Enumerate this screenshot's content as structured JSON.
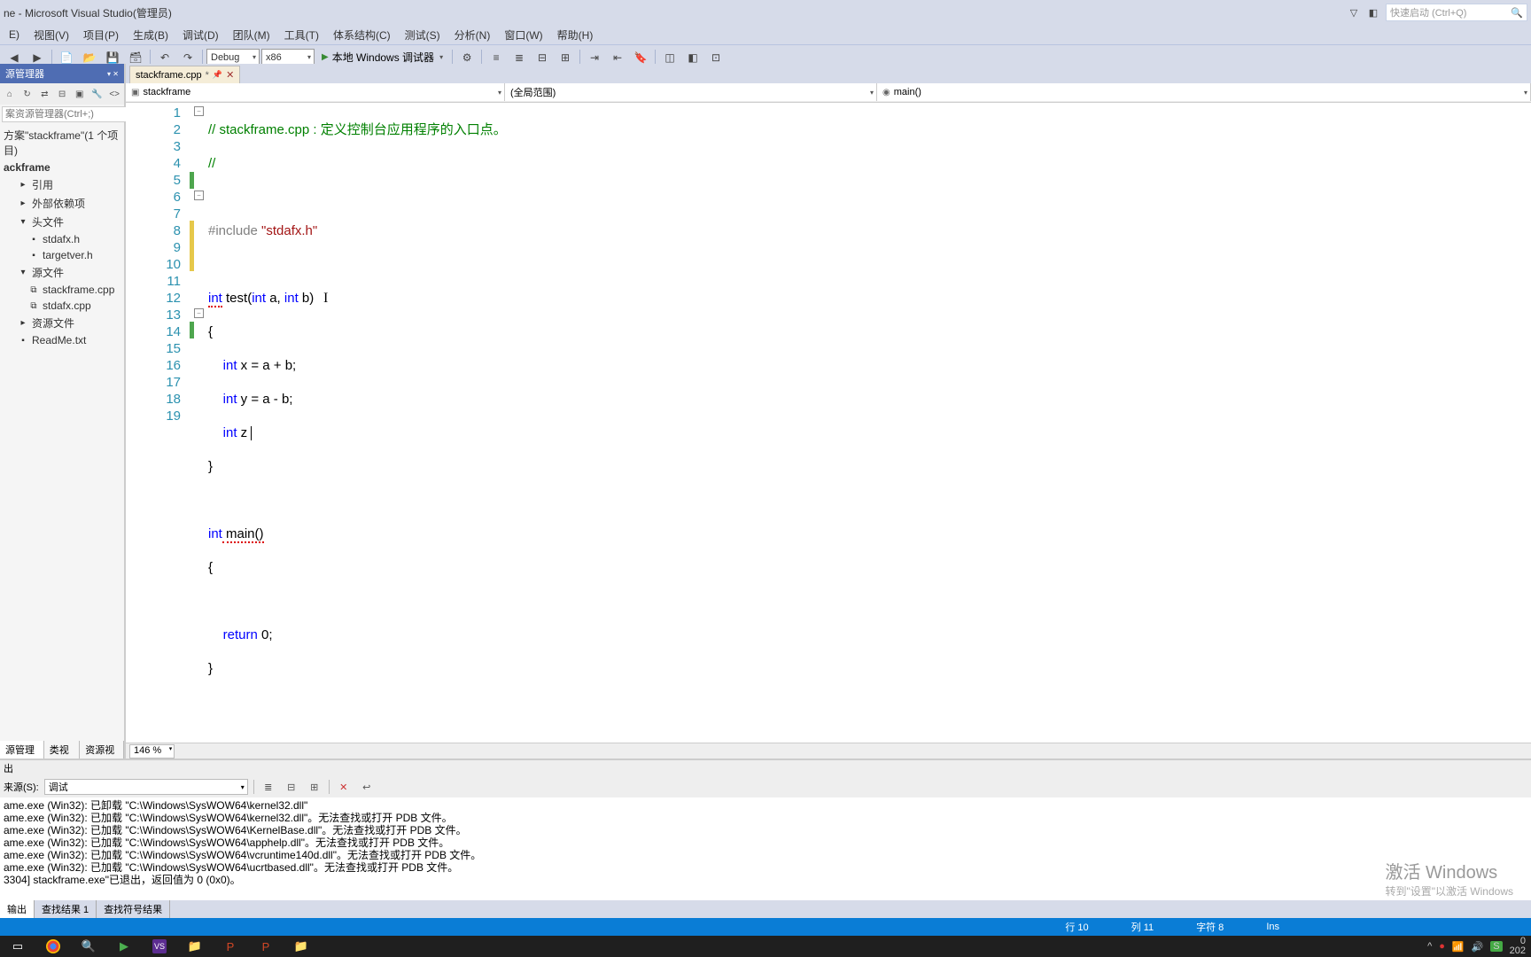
{
  "titlebar": {
    "title": "ne - Microsoft Visual Studio(管理员)",
    "quicklaunch_placeholder": "快速启动 (Ctrl+Q)"
  },
  "menu": {
    "items": [
      "E)",
      "视图(V)",
      "项目(P)",
      "生成(B)",
      "调试(D)",
      "团队(M)",
      "工具(T)",
      "体系结构(C)",
      "测试(S)",
      "分析(N)",
      "窗口(W)",
      "帮助(H)"
    ]
  },
  "toolbar": {
    "config": "Debug",
    "platform": "x86",
    "debugger_label": "本地 Windows 调试器"
  },
  "solution_explorer": {
    "title": "源管理器",
    "search_placeholder": "案资源管理器(Ctrl+;)",
    "solution_line": "方案\"stackframe\"(1 个项目)",
    "project": "ackframe",
    "nodes": [
      "引用",
      "外部依赖项",
      "头文件",
      "stdafx.h",
      "targetver.h",
      "源文件",
      "stackframe.cpp",
      "stdafx.cpp",
      "资源文件",
      "ReadMe.txt"
    ],
    "bottom_tabs": [
      "源管理器",
      "类视图",
      "资源视图"
    ]
  },
  "editor": {
    "tab_name": "stackframe.cpp",
    "nav_class": "stackframe",
    "nav_scope": "(全局范围)",
    "nav_func": "main()",
    "zoom": "146 %",
    "lines": {
      "l1_a": "// stackframe.cpp : ",
      "l1_b": "定义控制台应用程序的入口点。",
      "l2": "//",
      "l4_a": "#include ",
      "l4_b": "\"stdafx.h\"",
      "l6_a": "int",
      "l6_b": " test(",
      "l6_c": "int",
      "l6_d": " a, ",
      "l6_e": "int",
      "l6_f": " b)",
      "l7": "{",
      "l8_a": "    ",
      "l8_b": "int",
      "l8_c": " x = a + b;",
      "l9_a": "    ",
      "l9_b": "int",
      "l9_c": " y = a - b;",
      "l10_a": "    ",
      "l10_b": "int",
      "l10_c": " z ",
      "l11": "}",
      "l13_a": "int",
      "l13_b": " main()",
      "l14": "{",
      "l16_a": "    ",
      "l16_b": "return",
      "l16_c": " 0;",
      "l17": "}"
    }
  },
  "output": {
    "title": "出",
    "source_label": "来源(S):",
    "source_value": "调试",
    "lines": [
      "ame.exe (Win32): 已卸载 \"C:\\Windows\\SysWOW64\\kernel32.dll\"",
      "ame.exe (Win32): 已加载 \"C:\\Windows\\SysWOW64\\kernel32.dll\"。无法查找或打开 PDB 文件。",
      "ame.exe (Win32): 已加载 \"C:\\Windows\\SysWOW64\\KernelBase.dll\"。无法查找或打开 PDB 文件。",
      "ame.exe (Win32): 已加载 \"C:\\Windows\\SysWOW64\\apphelp.dll\"。无法查找或打开 PDB 文件。",
      "ame.exe (Win32): 已加载 \"C:\\Windows\\SysWOW64\\vcruntime140d.dll\"。无法查找或打开 PDB 文件。",
      "ame.exe (Win32): 已加载 \"C:\\Windows\\SysWOW64\\ucrtbased.dll\"。无法查找或打开 PDB 文件。",
      "3304] stackframe.exe\"已退出，返回值为 0 (0x0)。"
    ],
    "tabs": [
      "输出",
      "查找结果 1",
      "查找符号结果"
    ]
  },
  "status": {
    "line_label": "行 10",
    "col_label": "列 11",
    "char_label": "字符 8",
    "ins": "Ins"
  },
  "activate": {
    "l1": "激活 Windows",
    "l2": "转到\"设置\"以激活 Windows"
  },
  "tray": {
    "t1": "0",
    "t2": "202"
  }
}
